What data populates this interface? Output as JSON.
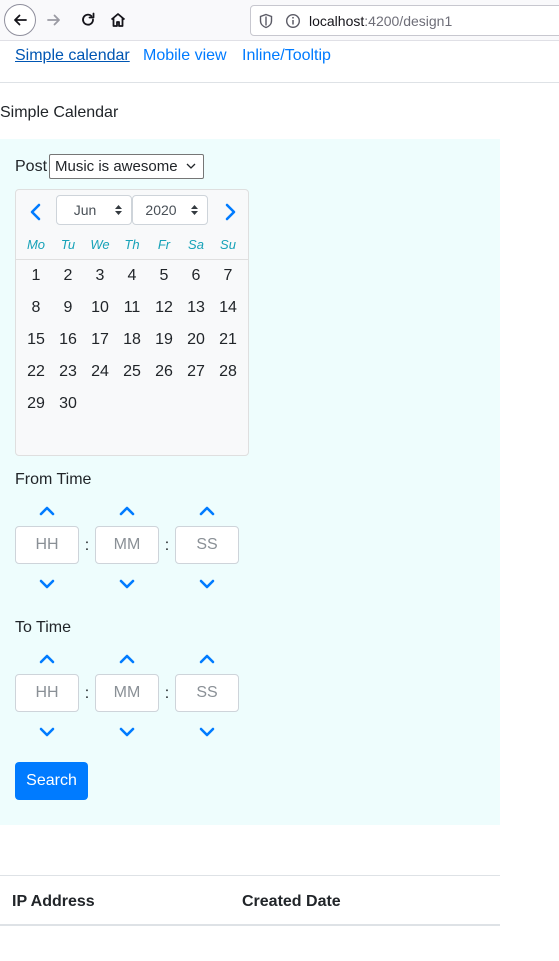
{
  "browser": {
    "url_host": "localhost",
    "url_path": ":4200/design1"
  },
  "nav": {
    "links": [
      {
        "label": "Simple calendar"
      },
      {
        "label": "Mobile view"
      },
      {
        "label": "Inline/Tooltip"
      }
    ]
  },
  "page": {
    "heading": "Simple Calendar"
  },
  "form": {
    "post_label": "Post",
    "post_selected": "Music is awesome",
    "calendar": {
      "month": "Jun",
      "year": "2020",
      "weekdays": [
        "Mo",
        "Tu",
        "We",
        "Th",
        "Fr",
        "Sa",
        "Su"
      ],
      "weeks": [
        [
          "1",
          "2",
          "3",
          "4",
          "5",
          "6",
          "7"
        ],
        [
          "8",
          "9",
          "10",
          "11",
          "12",
          "13",
          "14"
        ],
        [
          "15",
          "16",
          "17",
          "18",
          "19",
          "20",
          "21"
        ],
        [
          "22",
          "23",
          "24",
          "25",
          "26",
          "27",
          "28"
        ],
        [
          "29",
          "30"
        ]
      ]
    },
    "from_time": {
      "label": "From Time",
      "hh_placeholder": "HH",
      "mm_placeholder": "MM",
      "ss_placeholder": "SS",
      "separator": ":"
    },
    "to_time": {
      "label": "To Time",
      "hh_placeholder": "HH",
      "mm_placeholder": "MM",
      "ss_placeholder": "SS",
      "separator": ":"
    },
    "search_label": "Search"
  },
  "table": {
    "headers": [
      "IP Address",
      "Created Date"
    ]
  },
  "colors": {
    "accent": "#007bff",
    "panel_bg": "#eefdfd",
    "weekday": "#17a2b8"
  }
}
